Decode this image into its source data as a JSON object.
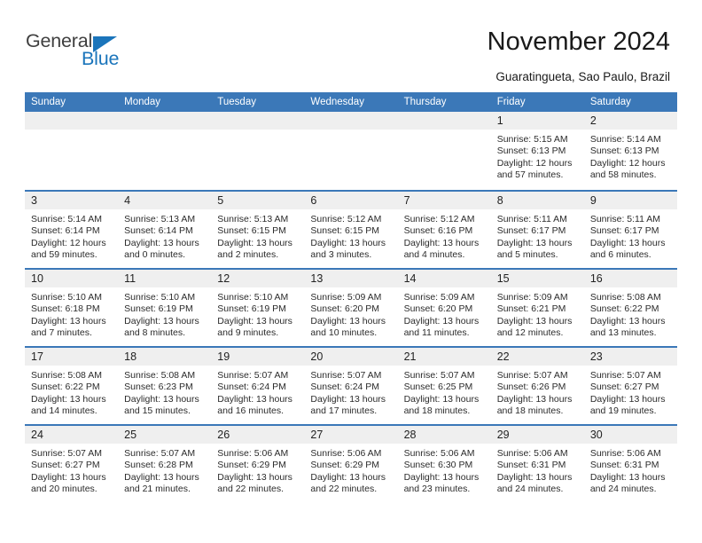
{
  "brand": {
    "logo_text_1": "General",
    "logo_text_2": "Blue",
    "logo_icon": "triangle-icon",
    "accent_color": "#1b75bb"
  },
  "header": {
    "title": "November 2024",
    "subtitle": "Guaratingueta, Sao Paulo, Brazil"
  },
  "calendar": {
    "header_color": "#3b78b8",
    "day_band_color": "#efefef",
    "weekdays": [
      "Sunday",
      "Monday",
      "Tuesday",
      "Wednesday",
      "Thursday",
      "Friday",
      "Saturday"
    ],
    "weeks": [
      [
        {
          "day": "",
          "sunrise": "",
          "sunset": "",
          "daylight_1": "",
          "daylight_2": ""
        },
        {
          "day": "",
          "sunrise": "",
          "sunset": "",
          "daylight_1": "",
          "daylight_2": ""
        },
        {
          "day": "",
          "sunrise": "",
          "sunset": "",
          "daylight_1": "",
          "daylight_2": ""
        },
        {
          "day": "",
          "sunrise": "",
          "sunset": "",
          "daylight_1": "",
          "daylight_2": ""
        },
        {
          "day": "",
          "sunrise": "",
          "sunset": "",
          "daylight_1": "",
          "daylight_2": ""
        },
        {
          "day": "1",
          "sunrise": "Sunrise: 5:15 AM",
          "sunset": "Sunset: 6:13 PM",
          "daylight_1": "Daylight: 12 hours",
          "daylight_2": "and 57 minutes."
        },
        {
          "day": "2",
          "sunrise": "Sunrise: 5:14 AM",
          "sunset": "Sunset: 6:13 PM",
          "daylight_1": "Daylight: 12 hours",
          "daylight_2": "and 58 minutes."
        }
      ],
      [
        {
          "day": "3",
          "sunrise": "Sunrise: 5:14 AM",
          "sunset": "Sunset: 6:14 PM",
          "daylight_1": "Daylight: 12 hours",
          "daylight_2": "and 59 minutes."
        },
        {
          "day": "4",
          "sunrise": "Sunrise: 5:13 AM",
          "sunset": "Sunset: 6:14 PM",
          "daylight_1": "Daylight: 13 hours",
          "daylight_2": "and 0 minutes."
        },
        {
          "day": "5",
          "sunrise": "Sunrise: 5:13 AM",
          "sunset": "Sunset: 6:15 PM",
          "daylight_1": "Daylight: 13 hours",
          "daylight_2": "and 2 minutes."
        },
        {
          "day": "6",
          "sunrise": "Sunrise: 5:12 AM",
          "sunset": "Sunset: 6:15 PM",
          "daylight_1": "Daylight: 13 hours",
          "daylight_2": "and 3 minutes."
        },
        {
          "day": "7",
          "sunrise": "Sunrise: 5:12 AM",
          "sunset": "Sunset: 6:16 PM",
          "daylight_1": "Daylight: 13 hours",
          "daylight_2": "and 4 minutes."
        },
        {
          "day": "8",
          "sunrise": "Sunrise: 5:11 AM",
          "sunset": "Sunset: 6:17 PM",
          "daylight_1": "Daylight: 13 hours",
          "daylight_2": "and 5 minutes."
        },
        {
          "day": "9",
          "sunrise": "Sunrise: 5:11 AM",
          "sunset": "Sunset: 6:17 PM",
          "daylight_1": "Daylight: 13 hours",
          "daylight_2": "and 6 minutes."
        }
      ],
      [
        {
          "day": "10",
          "sunrise": "Sunrise: 5:10 AM",
          "sunset": "Sunset: 6:18 PM",
          "daylight_1": "Daylight: 13 hours",
          "daylight_2": "and 7 minutes."
        },
        {
          "day": "11",
          "sunrise": "Sunrise: 5:10 AM",
          "sunset": "Sunset: 6:19 PM",
          "daylight_1": "Daylight: 13 hours",
          "daylight_2": "and 8 minutes."
        },
        {
          "day": "12",
          "sunrise": "Sunrise: 5:10 AM",
          "sunset": "Sunset: 6:19 PM",
          "daylight_1": "Daylight: 13 hours",
          "daylight_2": "and 9 minutes."
        },
        {
          "day": "13",
          "sunrise": "Sunrise: 5:09 AM",
          "sunset": "Sunset: 6:20 PM",
          "daylight_1": "Daylight: 13 hours",
          "daylight_2": "and 10 minutes."
        },
        {
          "day": "14",
          "sunrise": "Sunrise: 5:09 AM",
          "sunset": "Sunset: 6:20 PM",
          "daylight_1": "Daylight: 13 hours",
          "daylight_2": "and 11 minutes."
        },
        {
          "day": "15",
          "sunrise": "Sunrise: 5:09 AM",
          "sunset": "Sunset: 6:21 PM",
          "daylight_1": "Daylight: 13 hours",
          "daylight_2": "and 12 minutes."
        },
        {
          "day": "16",
          "sunrise": "Sunrise: 5:08 AM",
          "sunset": "Sunset: 6:22 PM",
          "daylight_1": "Daylight: 13 hours",
          "daylight_2": "and 13 minutes."
        }
      ],
      [
        {
          "day": "17",
          "sunrise": "Sunrise: 5:08 AM",
          "sunset": "Sunset: 6:22 PM",
          "daylight_1": "Daylight: 13 hours",
          "daylight_2": "and 14 minutes."
        },
        {
          "day": "18",
          "sunrise": "Sunrise: 5:08 AM",
          "sunset": "Sunset: 6:23 PM",
          "daylight_1": "Daylight: 13 hours",
          "daylight_2": "and 15 minutes."
        },
        {
          "day": "19",
          "sunrise": "Sunrise: 5:07 AM",
          "sunset": "Sunset: 6:24 PM",
          "daylight_1": "Daylight: 13 hours",
          "daylight_2": "and 16 minutes."
        },
        {
          "day": "20",
          "sunrise": "Sunrise: 5:07 AM",
          "sunset": "Sunset: 6:24 PM",
          "daylight_1": "Daylight: 13 hours",
          "daylight_2": "and 17 minutes."
        },
        {
          "day": "21",
          "sunrise": "Sunrise: 5:07 AM",
          "sunset": "Sunset: 6:25 PM",
          "daylight_1": "Daylight: 13 hours",
          "daylight_2": "and 18 minutes."
        },
        {
          "day": "22",
          "sunrise": "Sunrise: 5:07 AM",
          "sunset": "Sunset: 6:26 PM",
          "daylight_1": "Daylight: 13 hours",
          "daylight_2": "and 18 minutes."
        },
        {
          "day": "23",
          "sunrise": "Sunrise: 5:07 AM",
          "sunset": "Sunset: 6:27 PM",
          "daylight_1": "Daylight: 13 hours",
          "daylight_2": "and 19 minutes."
        }
      ],
      [
        {
          "day": "24",
          "sunrise": "Sunrise: 5:07 AM",
          "sunset": "Sunset: 6:27 PM",
          "daylight_1": "Daylight: 13 hours",
          "daylight_2": "and 20 minutes."
        },
        {
          "day": "25",
          "sunrise": "Sunrise: 5:07 AM",
          "sunset": "Sunset: 6:28 PM",
          "daylight_1": "Daylight: 13 hours",
          "daylight_2": "and 21 minutes."
        },
        {
          "day": "26",
          "sunrise": "Sunrise: 5:06 AM",
          "sunset": "Sunset: 6:29 PM",
          "daylight_1": "Daylight: 13 hours",
          "daylight_2": "and 22 minutes."
        },
        {
          "day": "27",
          "sunrise": "Sunrise: 5:06 AM",
          "sunset": "Sunset: 6:29 PM",
          "daylight_1": "Daylight: 13 hours",
          "daylight_2": "and 22 minutes."
        },
        {
          "day": "28",
          "sunrise": "Sunrise: 5:06 AM",
          "sunset": "Sunset: 6:30 PM",
          "daylight_1": "Daylight: 13 hours",
          "daylight_2": "and 23 minutes."
        },
        {
          "day": "29",
          "sunrise": "Sunrise: 5:06 AM",
          "sunset": "Sunset: 6:31 PM",
          "daylight_1": "Daylight: 13 hours",
          "daylight_2": "and 24 minutes."
        },
        {
          "day": "30",
          "sunrise": "Sunrise: 5:06 AM",
          "sunset": "Sunset: 6:31 PM",
          "daylight_1": "Daylight: 13 hours",
          "daylight_2": "and 24 minutes."
        }
      ]
    ]
  }
}
